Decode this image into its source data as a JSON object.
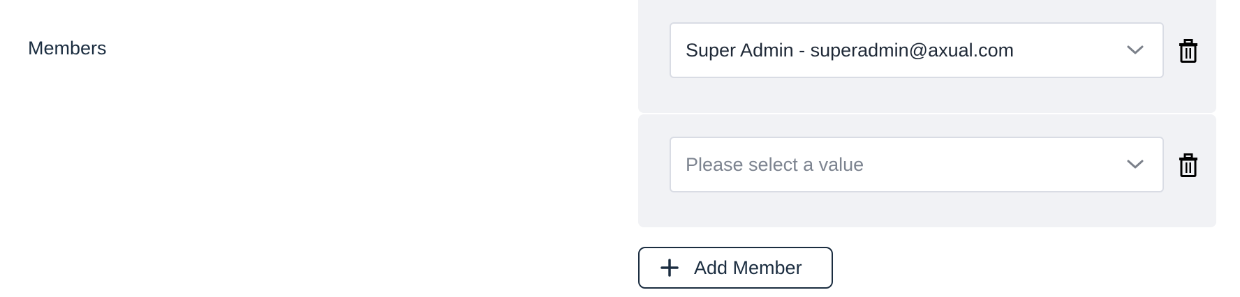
{
  "form": {
    "members_label": "Members"
  },
  "members": {
    "rows": [
      {
        "value": "Super Admin - superadmin@axual.com",
        "is_placeholder": false
      },
      {
        "value": "Please select a value",
        "is_placeholder": true
      }
    ],
    "add_button_label": "Add Member"
  },
  "icons": {
    "select": "chevron-down-icon",
    "remove": "trash-icon",
    "add": "plus-icon"
  },
  "colors": {
    "text_primary": "#1b2d40",
    "row_background": "#f1f2f5",
    "placeholder_text": "#7d8490",
    "border": "#d9dce4"
  }
}
